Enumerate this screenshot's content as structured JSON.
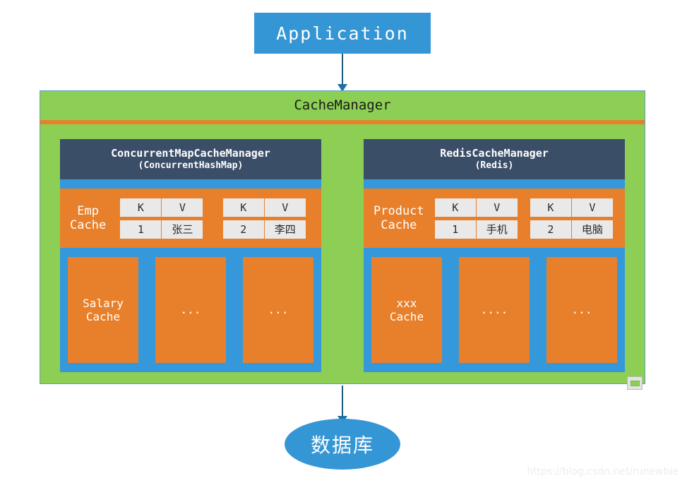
{
  "application": {
    "label": "Application"
  },
  "cache_manager": {
    "title": "CacheManager",
    "managers": [
      {
        "header_line1": "ConcurrentMapCacheManager",
        "header_line2": "(ConcurrentHashMap)",
        "cache_label": "Emp\nCache",
        "kv_tables": [
          {
            "header": [
              "K",
              "V"
            ],
            "row": [
              "1",
              "张三"
            ]
          },
          {
            "header": [
              "K",
              "V"
            ],
            "row": [
              "2",
              "李四"
            ]
          }
        ],
        "cache_boxes": [
          "Salary\nCache",
          "...",
          "..."
        ]
      },
      {
        "header_line1": "RedisCacheManager",
        "header_line2": "(Redis)",
        "cache_label": "Product\nCache",
        "kv_tables": [
          {
            "header": [
              "K",
              "V"
            ],
            "row": [
              "1",
              "手机"
            ]
          },
          {
            "header": [
              "K",
              "V"
            ],
            "row": [
              "2",
              "电脑"
            ]
          }
        ],
        "cache_boxes": [
          "xxx\nCache",
          "....",
          "..."
        ]
      }
    ]
  },
  "database": {
    "label": "数据库"
  },
  "watermark": {
    "text": "https://blog.csdn.net/runewbie"
  },
  "icons": {
    "resize_handle": "resize-handle-icon",
    "arrow_down": "arrow-down-icon"
  },
  "colors": {
    "blue": "#3596D5",
    "green": "#8DCE54",
    "orange": "#E8802B",
    "slate": "#3B4E68",
    "band_blue": "#3498DB",
    "cell_gray": "#E9E9E9",
    "connector": "#1F5C7A"
  }
}
